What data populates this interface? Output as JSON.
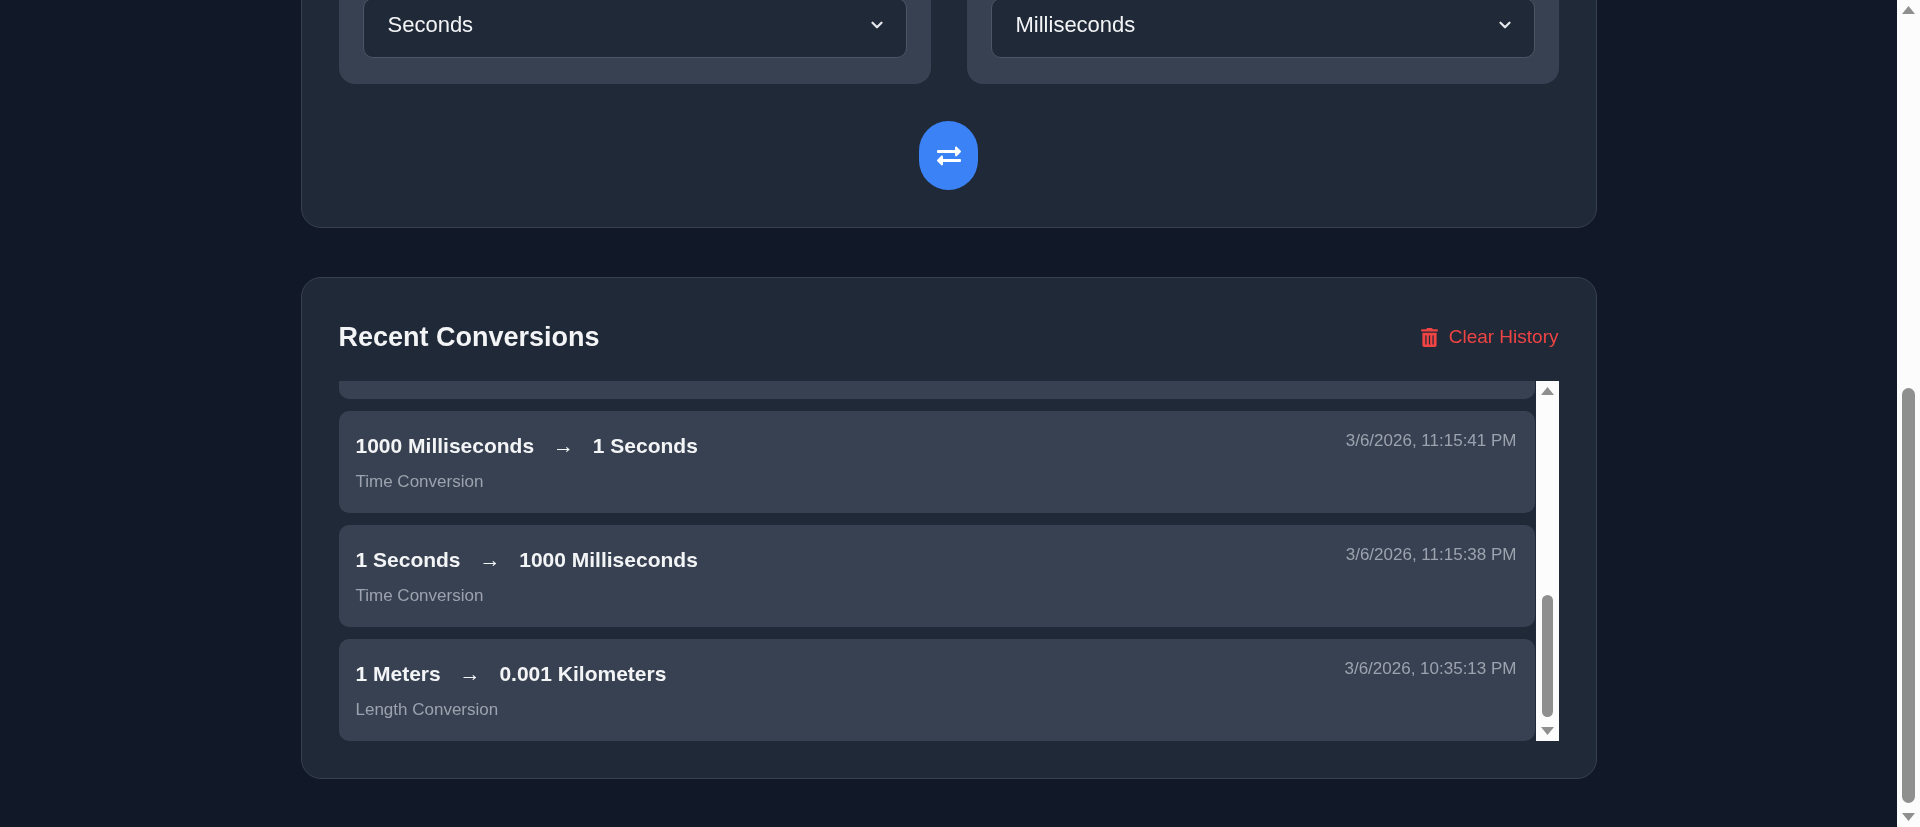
{
  "converter": {
    "selects": [
      {
        "value": "Seconds"
      },
      {
        "value": "Milliseconds"
      }
    ]
  },
  "history": {
    "title": "Recent Conversions",
    "clear_button": "Clear History",
    "items": [
      {
        "from": "1000 Milliseconds",
        "arrow": "→",
        "to": "1 Seconds",
        "category": "Time Conversion",
        "timestamp": "3/6/2026, 11:15:41 PM"
      },
      {
        "from": "1 Seconds",
        "arrow": "→",
        "to": "1000 Milliseconds",
        "category": "Time Conversion",
        "timestamp": "3/6/2026, 11:15:38 PM"
      },
      {
        "from": "1 Meters",
        "arrow": "→",
        "to": "0.001 Kilometers",
        "category": "Length Conversion",
        "timestamp": "3/6/2026, 10:35:13 PM"
      }
    ]
  }
}
